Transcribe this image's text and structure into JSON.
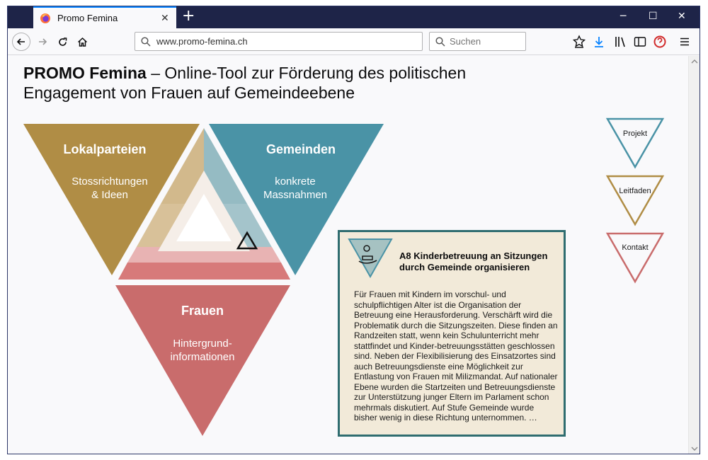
{
  "browser": {
    "tab_title": "Promo Femina",
    "url": "www.promo-femina.ch",
    "search_placeholder": "Suchen",
    "new_tab_symbol": "+",
    "close_symbol": "✕"
  },
  "page": {
    "title_bold": "PROMO Femina",
    "title_rest": " – Online-Tool zur Förderung des politischen Engagement von Frauen auf Gemeindeebene"
  },
  "triangles": {
    "lokalparteien": {
      "title": "Lokalparteien",
      "line1": "Stossrichtungen",
      "line2": "& Ideen",
      "color": "#b08d45"
    },
    "gemeinden": {
      "title": "Gemeinden",
      "line1": "konkrete",
      "line2": "Massnahmen",
      "color": "#4a93a6"
    },
    "frauen": {
      "title": "Frauen",
      "line1": "Hintergrund-",
      "line2": "informationen",
      "color": "#c96c6c"
    }
  },
  "card": {
    "title": "A8 Kinderbetreuung an Sitzungen durch Gemeinde organisieren",
    "body": "Für Frauen mit Kindern im vorschul- und schulpflichtigen Alter ist die Organisation der Betreuung eine Herausforderung. Verschärft wird die Problematik durch die Sitzungszeiten. Diese finden an Randzeiten statt, wenn kein Schulunterricht mehr stattfindet und Kinder-betreuungsstätten geschlossen sind. Neben der Flexibilisierung des Einsatzortes sind auch Betreuungsdienste eine Möglichkeit zur Entlastung von Frauen mit Milizmandat. Auf nationaler Ebene wurden die Startzeiten und Betreuungsdienste zur Unterstützung junger Eltern im Parlament schon mehrmals diskutiert. Auf Stufe Gemeinde wurde bisher wenig in diese Richtung unternommen. …",
    "border_color": "#2f6d70",
    "bg_color": "#f2ead9"
  },
  "side_nav": [
    {
      "label": "Projekt",
      "color": "#4a93a6"
    },
    {
      "label": "Leitfaden",
      "color": "#b08d45"
    },
    {
      "label": "Kontakt",
      "color": "#c96c6c"
    }
  ]
}
